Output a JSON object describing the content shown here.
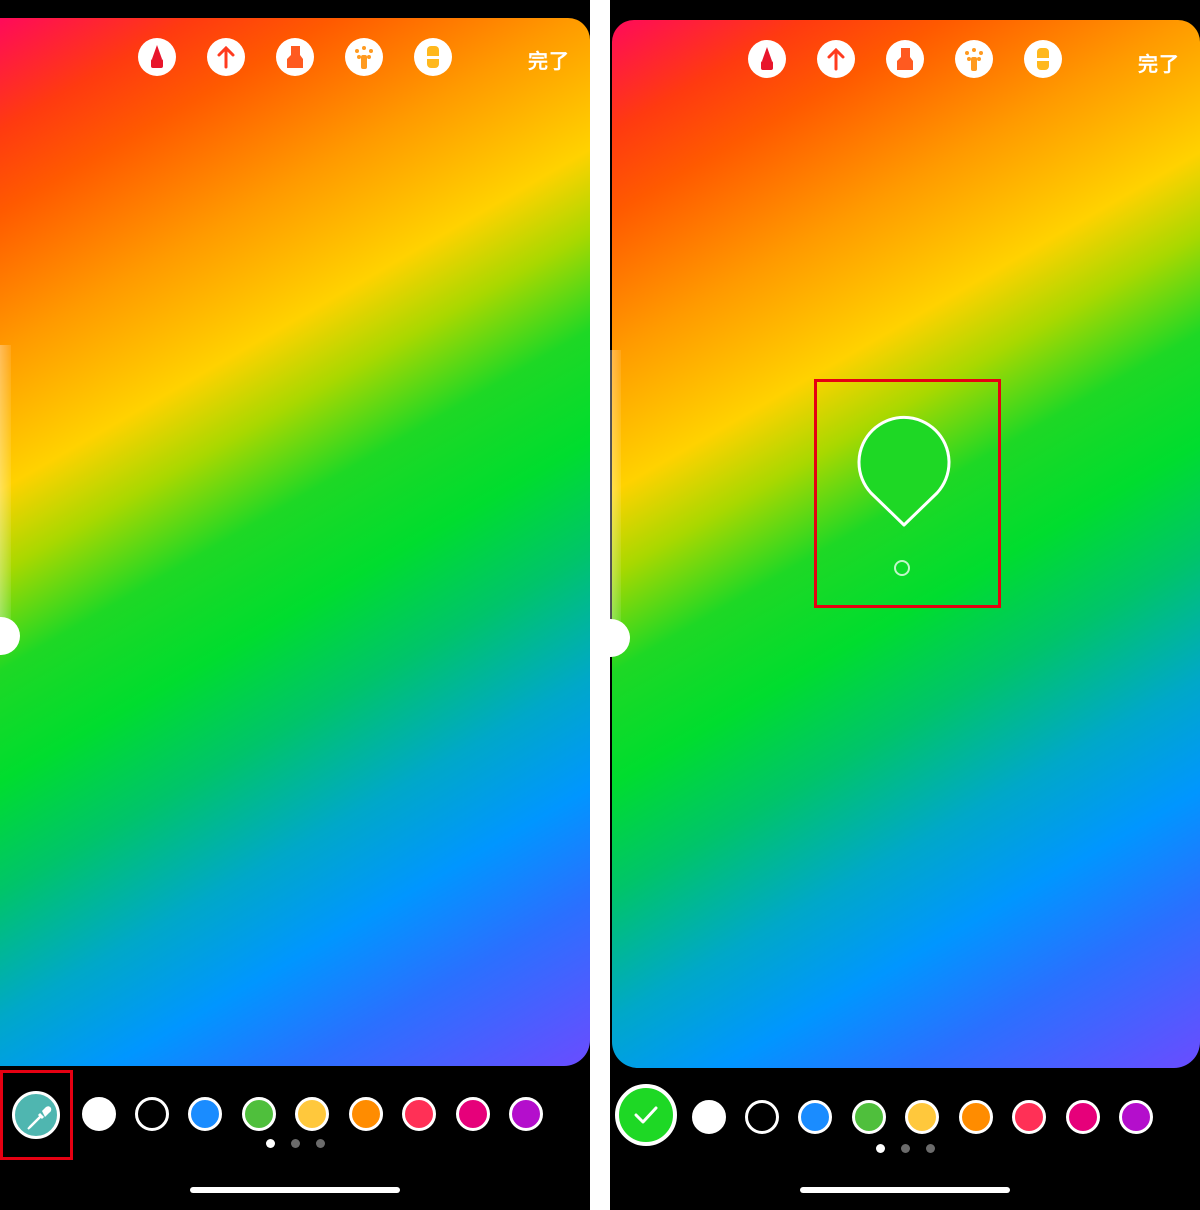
{
  "left_panel": {
    "done_label": "完了",
    "toolbar_icons": [
      "marker-pen-icon",
      "arrow-pen-icon",
      "highlighter-icon",
      "neon-pen-icon",
      "eraser-icon"
    ],
    "current_tool": "eyedropper-icon",
    "palette": [
      "#ffffff",
      "#000000",
      "#1a8cff",
      "#4fbf3c",
      "#ffc83c",
      "#ff8c00",
      "#ff3056",
      "#e6007a",
      "#b40ecc"
    ],
    "page_indicator": {
      "count": 3,
      "active": 1
    }
  },
  "right_panel": {
    "done_label": "完了",
    "toolbar_icons": [
      "marker-pen-icon",
      "arrow-pen-icon",
      "highlighter-icon",
      "neon-pen-icon",
      "eraser-icon"
    ],
    "picked_color": "#1ed825",
    "confirm_icon": "checkmark-icon",
    "palette": [
      "#ffffff",
      "#000000",
      "#1a8cff",
      "#4fbf3c",
      "#ffc83c",
      "#ff8c00",
      "#ff3056",
      "#e6007a",
      "#b40ecc"
    ],
    "page_indicator": {
      "count": 3,
      "active": 1
    }
  },
  "colors": {
    "highlight_frame": "#e60012",
    "eyedropper_button": "#4fb6b0"
  }
}
